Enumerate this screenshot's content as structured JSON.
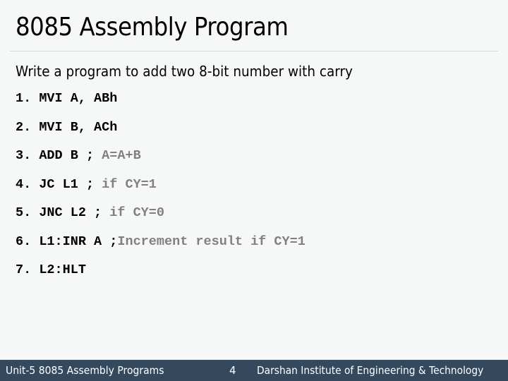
{
  "slide": {
    "title": "8085 Assembly Program",
    "subtitle": "Write a program to add two 8-bit number with carry",
    "code_lines": [
      {
        "number": "1.",
        "code": "MVI A, ABh",
        "separator": "",
        "comment": ""
      },
      {
        "number": "2.",
        "code": "MVI B, ACh",
        "separator": "",
        "comment": ""
      },
      {
        "number": "3.",
        "code": "ADD B",
        "separator": " ; ",
        "comment": "A=A+B"
      },
      {
        "number": "4.",
        "code": "JC L1",
        "separator": " ; ",
        "comment": "if CY=1"
      },
      {
        "number": "5.",
        "code": "JNC L2",
        "separator": " ; ",
        "comment": "if CY=0"
      },
      {
        "number": "6.",
        "code": "L1:INR A",
        "separator": " ;",
        "comment": "Increment result if CY=1"
      },
      {
        "number": "7.",
        "code": "L2:HLT",
        "separator": "",
        "comment": ""
      }
    ]
  },
  "footer": {
    "left": "Unit-5 8085 Assembly Programs",
    "page_number": "4",
    "right": "Darshan Institute of Engineering & Technology"
  },
  "colors": {
    "background": "#f6f8f8",
    "footer_background": "#34495e",
    "comment": "#808080"
  }
}
